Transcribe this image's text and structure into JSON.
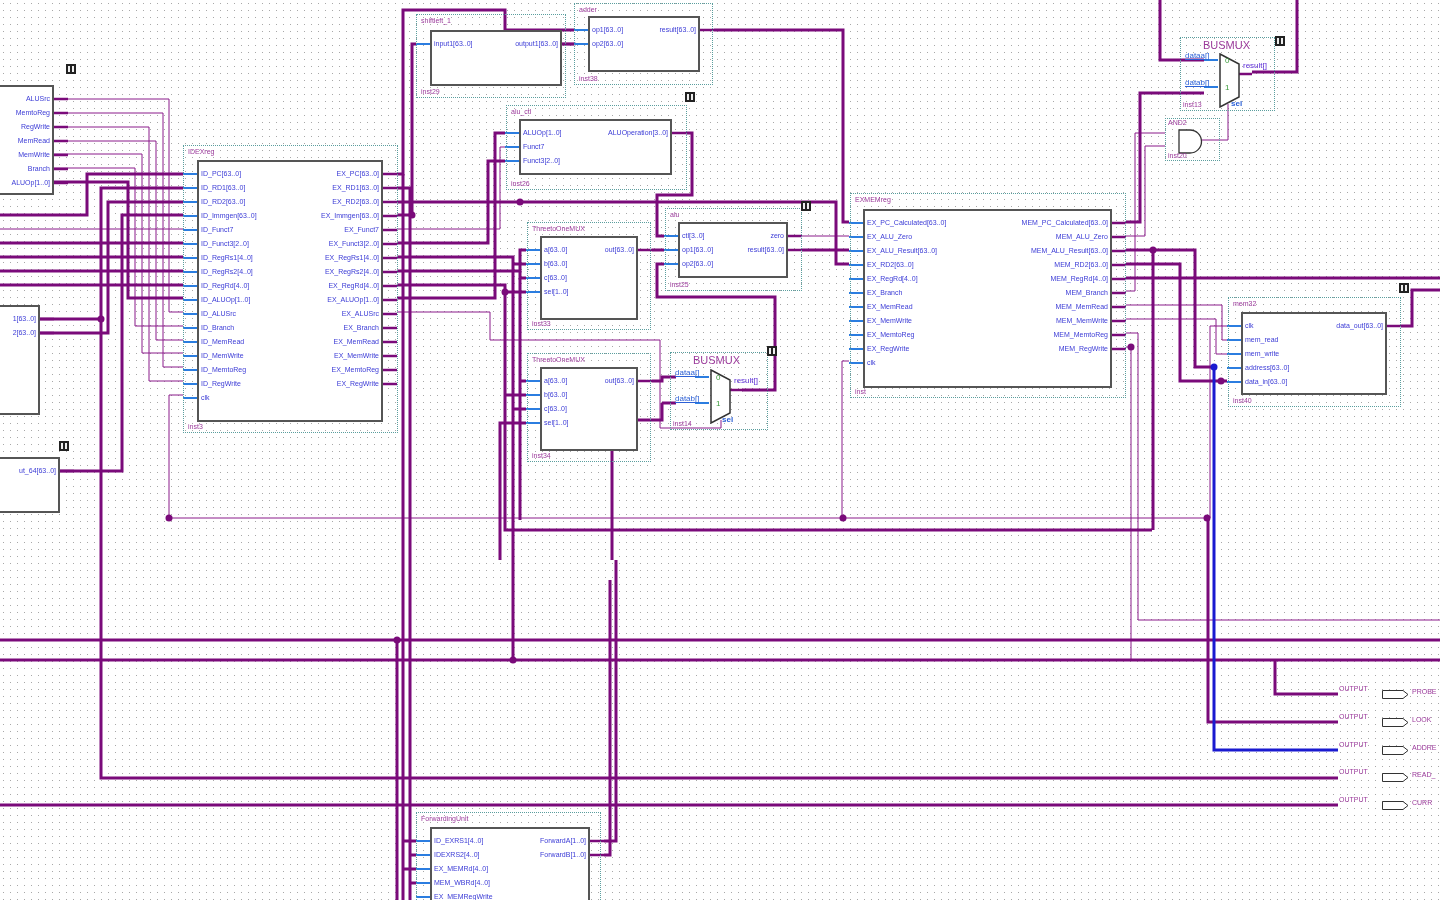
{
  "blocks": [
    {
      "kind": "block",
      "outputs": [
        "ALUSrc",
        "MemtoReg",
        "RegWrite",
        "MemRead",
        "MemWrite",
        "Branch",
        "ALUOp[1..0]"
      ]
    },
    {
      "kind": "block",
      "outputs": [
        "1[63..0]",
        "2[63..0]"
      ]
    },
    {
      "kind": "block",
      "outputs": [
        "ut_64[63..0]"
      ]
    },
    {
      "kind": "block",
      "title": "IDEXreg",
      "instance": "inst3",
      "inputs": [
        "ID_PC[63..0]",
        "ID_RD1[63..0]",
        "ID_RD2[63..0]",
        "ID_Immgen[63..0]",
        "ID_Funct7",
        "ID_Funct3[2..0]",
        "ID_RegRs1[4..0]",
        "ID_RegRs2[4..0]",
        "ID_RegRd[4..0]",
        "ID_ALUOp[1..0]",
        "ID_ALUSrc",
        "ID_Branch",
        "ID_MemRead",
        "ID_MemWrite",
        "ID_MemtoReg",
        "ID_RegWrite",
        "clk"
      ],
      "outputs": [
        "EX_PC[63..0]",
        "EX_RD1[63..0]",
        "EX_RD2[63..0]",
        "EX_Immgen[63..0]",
        "EX_Funct7",
        "EX_Funct3[2..0]",
        "EX_RegRs1[4..0]",
        "EX_RegRs2[4..0]",
        "EX_RegRd[4..0]",
        "EX_ALUOp[1..0]",
        "EX_ALUSrc",
        "EX_Branch",
        "EX_MemRead",
        "EX_MemWrite",
        "EX_MemtoReg",
        "EX_RegWrite"
      ]
    },
    {
      "kind": "block",
      "title": "shiftleft_1",
      "instance": "inst29",
      "inputs": [
        "input1[63..0]"
      ],
      "outputs": [
        "output1[63..0]"
      ]
    },
    {
      "kind": "block",
      "title": "adder",
      "instance": "inst38",
      "inputs": [
        "op1[63..0]",
        "op2[63..0]"
      ],
      "outputs": [
        "result[63..0]"
      ]
    },
    {
      "kind": "block",
      "title": "alu_ctl",
      "instance": "inst26",
      "inputs": [
        "ALUOp[1..0]",
        "Funct7",
        "Funct3[2..0]"
      ],
      "outputs": [
        "ALUOperation[3..0]"
      ]
    },
    {
      "kind": "block",
      "title": "ThreetoOneMUX",
      "instance": "inst33",
      "inputs": [
        "a[63..0]",
        "b[63..0]",
        "c[63..0]",
        "sel[1..0]"
      ],
      "outputs": [
        "out[63..0]"
      ]
    },
    {
      "kind": "block",
      "title": "alu",
      "instance": "inst25",
      "inputs": [
        "ctl[3..0]",
        "op1[63..0]",
        "op2[63..0]"
      ],
      "outputs": [
        "zero",
        "result[63..0]"
      ]
    },
    {
      "kind": "block",
      "title": "ThreetoOneMUX",
      "instance": "inst34",
      "inputs": [
        "a[63..0]",
        "b[63..0]",
        "c[63..0]",
        "sel[1..0]"
      ],
      "outputs": [
        "out[63..0]"
      ]
    },
    {
      "kind": "block",
      "title": "EXMEMreg",
      "instance": "inst",
      "inputs": [
        "EX_PC_Calculated[63..0]",
        "EX_ALU_Zero",
        "EX_ALU_Result[63..0]",
        "EX_RD2[63..0]",
        "EX_RegRd[4..0]",
        "EX_Branch",
        "EX_MemRead",
        "EX_MemWrite",
        "EX_MemtoReg",
        "EX_RegWrite",
        "clk"
      ],
      "outputs": [
        "MEM_PC_Calculated[63..0]",
        "MEM_ALU_Zero",
        "MEM_ALU_Result[63..0]",
        "MEM_RD2[63..0]",
        "MEM_RegRd[4..0]",
        "MEM_Branch",
        "MEM_MemRead",
        "MEM_MemWrite",
        "MEM_MemtoReg",
        "MEM_RegWrite"
      ]
    },
    {
      "kind": "block",
      "title": "mem32",
      "instance": "inst40",
      "inputs": [
        "clk",
        "mem_read",
        "mem_write",
        "address[63..0]",
        "data_in[63..0]"
      ],
      "outputs": [
        "data_out[63..0]"
      ]
    },
    {
      "kind": "block",
      "title": "ForwardingUnit",
      "inputs": [
        "ID_EXRS1[4..0]",
        "IDEXRS2[4..0]",
        "EX_MEMRd[4..0]",
        "MEM_WBRd[4..0]",
        "EX_MEMRegWrite"
      ],
      "outputs": [
        "ForwardA[1..0]",
        "ForwardB[1..0]"
      ]
    }
  ],
  "muxes": [
    {
      "kind": "busmux",
      "title": "BUSMUX",
      "inputs": [
        "dataa[]",
        "datab[]"
      ],
      "input_numbers": [
        "0",
        "1"
      ],
      "output": "result[]",
      "select": "sel",
      "instance": "inst13"
    },
    {
      "kind": "busmux",
      "title": "BUSMUX",
      "inputs": [
        "dataa[]",
        "datab[]"
      ],
      "input_numbers": [
        "0",
        "1"
      ],
      "output": "result[]",
      "select": "sel",
      "instance": "inst14"
    }
  ],
  "gates": [
    {
      "kind": "and",
      "title": "AND2",
      "instance": "inst20"
    }
  ],
  "output_pins": [
    {
      "kind": "output",
      "type": "OUTPUT",
      "name": "PROBE"
    },
    {
      "kind": "output",
      "type": "OUTPUT",
      "name": "LOOK"
    },
    {
      "kind": "output",
      "type": "OUTPUT",
      "name": "ADDRE"
    },
    {
      "kind": "output",
      "type": "OUTPUT",
      "name": "READ_"
    },
    {
      "kind": "output",
      "type": "OUTPUT",
      "name": "CURR"
    }
  ]
}
